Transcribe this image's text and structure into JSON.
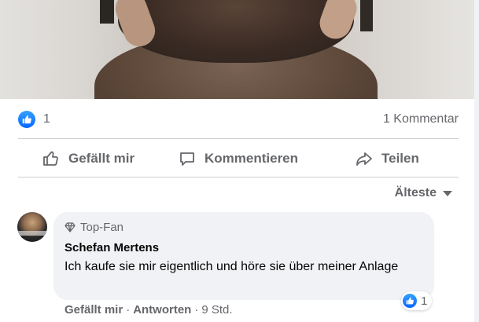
{
  "post": {
    "reaction_count": "1",
    "comment_count": "1 Kommentar"
  },
  "actions": {
    "like": "Gefällt mir",
    "comment": "Kommentieren",
    "share": "Teilen"
  },
  "sort": {
    "label": "Älteste"
  },
  "comment": {
    "badge": "Top-Fan",
    "author": "Schefan Mertens",
    "text": "Ich kaufe sie mir eigentlich und höre sie über meiner Anlage",
    "like_label": "Gefällt mir",
    "reply_label": "Antworten",
    "separator": "·",
    "time": "9 Std.",
    "reaction_count": "1"
  },
  "colors": {
    "accent": "#0866ff",
    "secondary_text": "#65676b",
    "bubble": "#f0f2f5"
  }
}
